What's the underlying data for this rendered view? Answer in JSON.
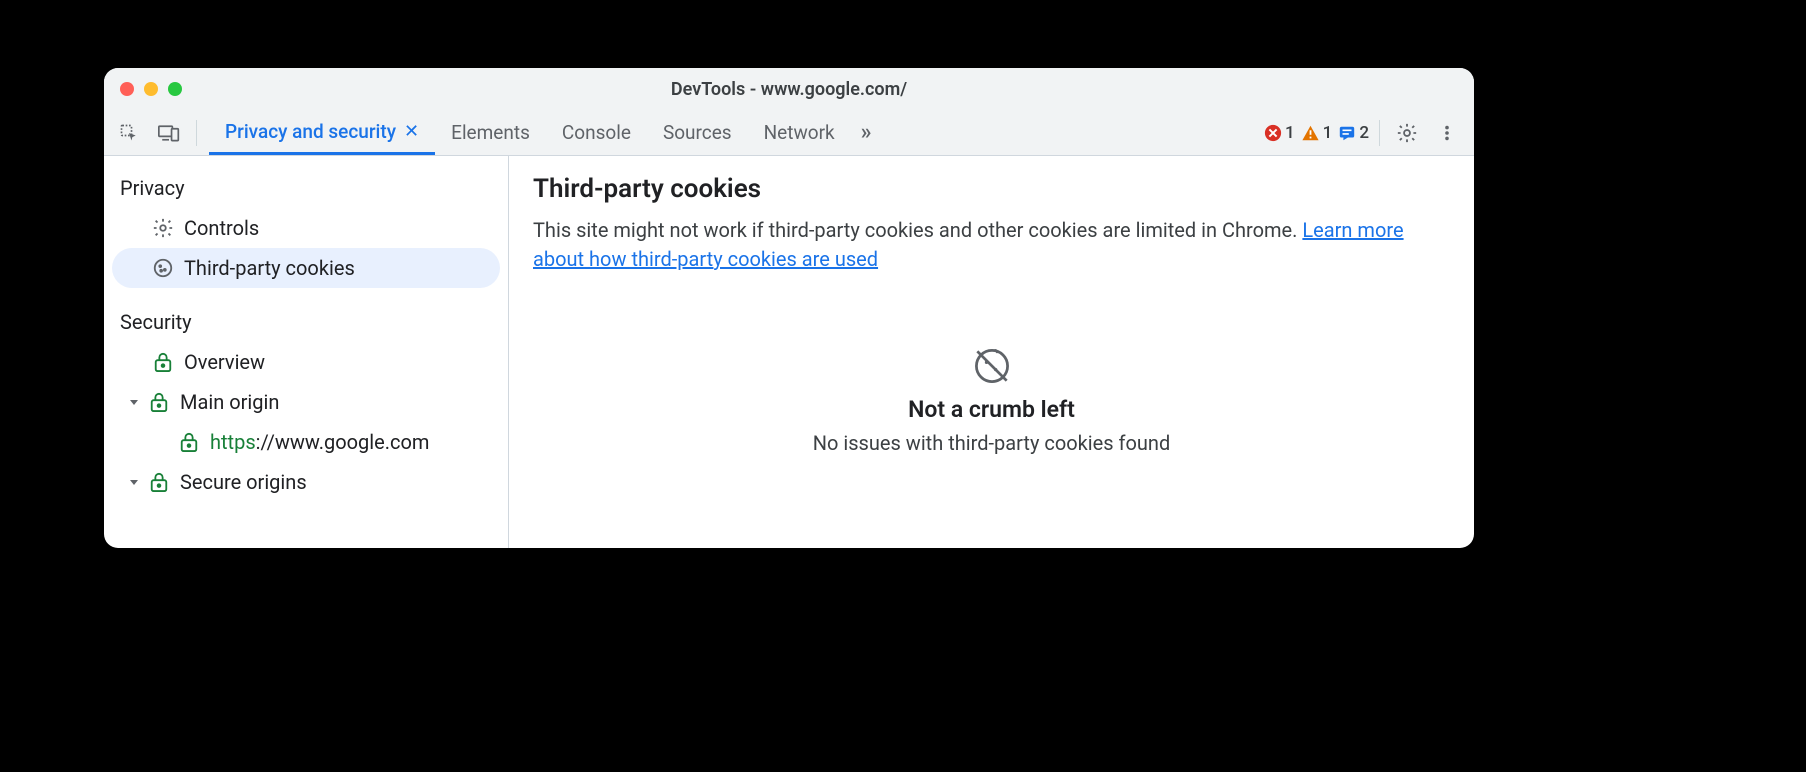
{
  "window": {
    "title": "DevTools - www.google.com/"
  },
  "tabs": {
    "active": "Privacy and security",
    "others": [
      "Elements",
      "Console",
      "Sources",
      "Network"
    ]
  },
  "status": {
    "errors": "1",
    "warnings": "1",
    "messages": "2"
  },
  "sidebar": {
    "privacy": {
      "title": "Privacy",
      "controls": "Controls",
      "thirdparty": "Third-party cookies"
    },
    "security": {
      "title": "Security",
      "overview": "Overview",
      "mainorigin": "Main origin",
      "origin_scheme": "https",
      "origin_rest": "://www.google.com",
      "secureorigins": "Secure origins"
    }
  },
  "main": {
    "heading": "Third-party cookies",
    "description": "This site might not work if third-party cookies and other cookies are limited in Chrome. ",
    "link": "Learn more about how third-party cookies are used",
    "empty_title": "Not a crumb left",
    "empty_sub": "No issues with third-party cookies found"
  }
}
